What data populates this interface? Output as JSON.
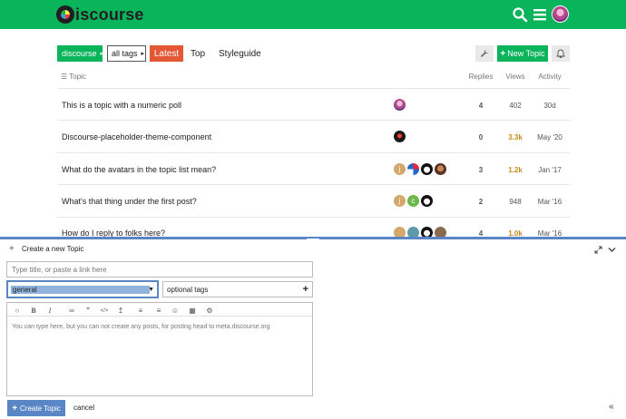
{
  "header": {
    "logo_text": "iscourse"
  },
  "nav": {
    "category": "discourse",
    "tags": "all tags",
    "latest": "Latest",
    "top": "Top",
    "styleguide": "Styleguide",
    "new_topic": "New Topic"
  },
  "table": {
    "headers": {
      "topic": "Topic",
      "replies": "Replies",
      "views": "Views",
      "activity": "Activity"
    },
    "rows": [
      {
        "title": "This is a topic with a numeric poll",
        "replies": "4",
        "views": "402",
        "activity": "30d",
        "views_color": "#555555"
      },
      {
        "title": "Discourse-placeholder-theme-component",
        "replies": "0",
        "views": "3.3k",
        "activity": "May '20",
        "views_color": "#c68a1e"
      },
      {
        "title": "What do the avatars in the topic list mean?",
        "replies": "3",
        "views": "1.2k",
        "activity": "Jan '17",
        "views_color": "#c68a1e"
      },
      {
        "title": "What's that thing under the first post?",
        "replies": "2",
        "views": "948",
        "activity": "Mar '16",
        "views_color": "#555555"
      },
      {
        "title": "How do I reply to folks here?",
        "replies": "4",
        "views": "1.0k",
        "activity": "Mar '16",
        "views_color": "#c68a1e"
      }
    ]
  },
  "composer": {
    "title": "Create a new Topic",
    "title_placeholder": "Type title, or paste a link here",
    "category_value": "general",
    "tags_placeholder": "optional tags",
    "editor_text": "You can type here, but you can not create any posts, for posting head to meta.discourse.org",
    "create_label": "Create Topic",
    "cancel_label": "cancel"
  },
  "colors": {
    "brand_green": "#0ab45a",
    "latest_red": "#e45735",
    "composer_blue": "#5b86c5"
  }
}
